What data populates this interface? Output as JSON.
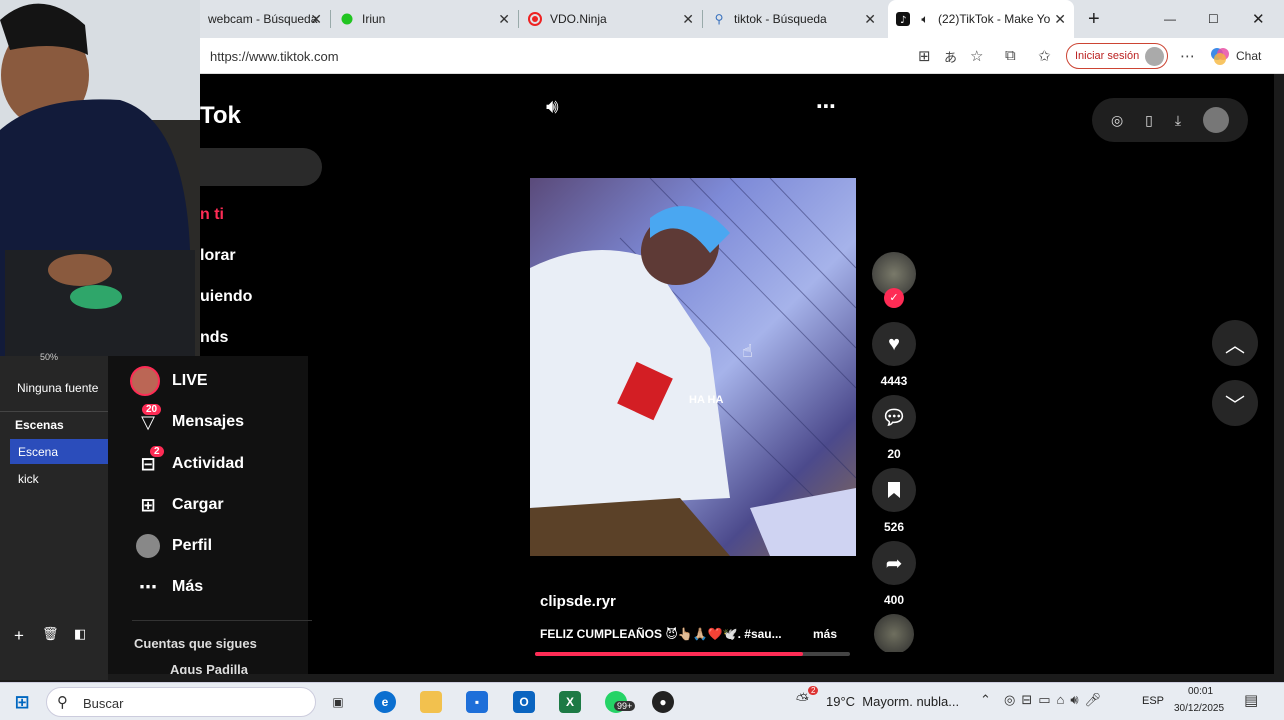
{
  "browser": {
    "tabs": [
      {
        "label": "webcam - Búsqueda",
        "icon": "search-icon"
      },
      {
        "label": "Iriun",
        "icon": "dot-icon"
      },
      {
        "label": "VDO.Ninja",
        "icon": "record-icon"
      },
      {
        "label": "tiktok - Búsqueda",
        "icon": "search-icon"
      },
      {
        "label": "(22)TikTok - Make Yo",
        "icon": "tiktok-icon"
      }
    ],
    "url": "https://www.tiktok.com",
    "signin_label": "Iniciar sesión",
    "chat_label": "Chat"
  },
  "tiktok": {
    "logo_text": "Tok",
    "nav": [
      {
        "label": "n ti"
      },
      {
        "label": "lorar"
      },
      {
        "label": "uiendo"
      },
      {
        "label": "nds"
      },
      {
        "label": "LIVE"
      },
      {
        "label": "Mensajes",
        "badge": "20"
      },
      {
        "label": "Actividad",
        "badge": "2"
      },
      {
        "label": "Cargar"
      },
      {
        "label": "Perfil"
      },
      {
        "label": "Más"
      }
    ],
    "following_heading": "Cuentas que sigues",
    "following_user": "Agus Padilla",
    "video": {
      "overlay_text": "HA HA",
      "author": "clipsde.ryr",
      "caption": "FELIZ CUMPLEAÑOS 😈👆🏼🙏🏼❤️🕊️. #sau...",
      "more_label": "más",
      "progress": 0.85
    },
    "rail": {
      "likes": "4443",
      "comments": "20",
      "saves": "526",
      "shares": "400"
    }
  },
  "obs": {
    "source_empty": "Ninguna fuente",
    "scenes_heading": "Escenas",
    "scenes": [
      "Escena",
      "kick"
    ],
    "zoom_label": "50%"
  },
  "taskbar": {
    "search_label": "Buscar",
    "weather": "19°C  Mayorm. nubla...",
    "lang": "ESP",
    "time": "00:01",
    "date": "30/12/2025",
    "whatsapp_badge": "99+",
    "weather_badge": "2"
  },
  "colors": {
    "accent": "#fe2c55",
    "edge_blue": "#0067c0"
  }
}
